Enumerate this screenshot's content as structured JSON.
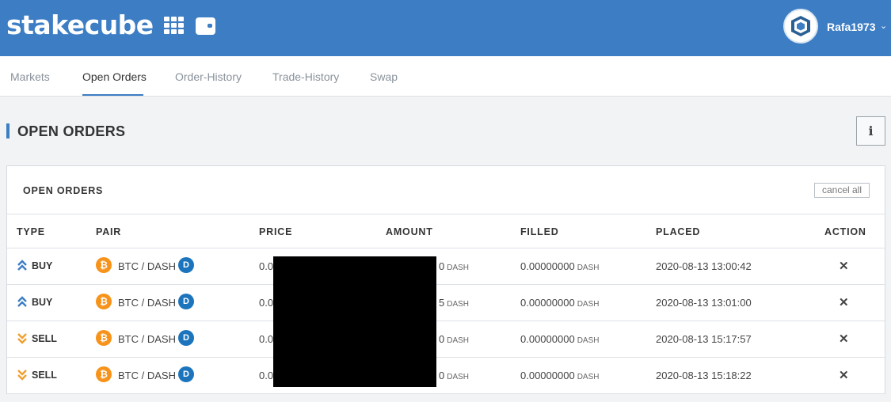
{
  "header": {
    "logo": "stakecube",
    "apps_icon": "grid-icon",
    "wallet_icon": "wallet-icon",
    "username": "Rafa1973",
    "user_menu_icon": "chevron-down-icon"
  },
  "nav": {
    "tabs": [
      {
        "label": "Markets",
        "active": false
      },
      {
        "label": "Open Orders",
        "active": true
      },
      {
        "label": "Order-History",
        "active": false
      },
      {
        "label": "Trade-History",
        "active": false
      },
      {
        "label": "Swap",
        "active": false
      }
    ]
  },
  "page": {
    "title": "OPEN ORDERS",
    "info_label": "i"
  },
  "panel": {
    "title": "OPEN ORDERS",
    "cancel_all_label": "cancel all",
    "columns": [
      "TYPE",
      "PAIR",
      "PRICE",
      "AMOUNT",
      "FILLED",
      "PLACED",
      "ACTION"
    ],
    "rows": [
      {
        "type": "BUY",
        "pair": "BTC / DASH",
        "price": "0.0",
        "amount": "0",
        "amount_unit": "DASH",
        "filled": "0.00000000",
        "filled_unit": "DASH",
        "placed": "2020-08-13 13:00:42",
        "action": "✕"
      },
      {
        "type": "BUY",
        "pair": "BTC / DASH",
        "price": "0.0",
        "amount": "5",
        "amount_unit": "DASH",
        "filled": "0.00000000",
        "filled_unit": "DASH",
        "placed": "2020-08-13 13:01:00",
        "action": "✕"
      },
      {
        "type": "SELL",
        "pair": "BTC / DASH",
        "price": "0.0",
        "amount": "0",
        "amount_unit": "DASH",
        "filled": "0.00000000",
        "filled_unit": "DASH",
        "placed": "2020-08-13 15:17:57",
        "action": "✕"
      },
      {
        "type": "SELL",
        "pair": "BTC / DASH",
        "price": "0.0",
        "amount": "0",
        "amount_unit": "DASH",
        "filled": "0.00000000",
        "filled_unit": "DASH",
        "placed": "2020-08-13 15:18:22",
        "action": "✕"
      }
    ]
  },
  "colors": {
    "brand_blue": "#3c7dc4",
    "buy": "#3c7dc4",
    "sell": "#f0a030",
    "btc": "#f7931a",
    "dash": "#1c75bc"
  }
}
